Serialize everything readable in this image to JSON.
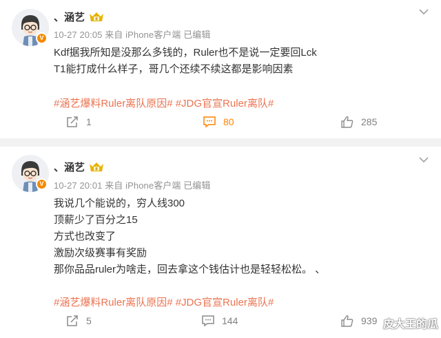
{
  "posts": [
    {
      "user": {
        "name": "、涵艺",
        "verified_badge": "V",
        "level_badge": "II"
      },
      "meta": "10-27 20:05  来自 iPhone客户端  已编辑",
      "content_lines": [
        "Kdf据我所知是没那么多钱的，Ruler也不是说一定要回Lck",
        "T1能打成什么样子，哥几个还续不续这都是影响因素"
      ],
      "tags": [
        "#涵艺爆料Ruler离队原因#",
        "#JDG官宣Ruler离队#"
      ],
      "actions": {
        "repost": "1",
        "comment": "80",
        "like": "285"
      }
    },
    {
      "user": {
        "name": "、涵艺",
        "verified_badge": "V",
        "level_badge": "II"
      },
      "meta": "10-27 20:01  来自 iPhone客户端  已编辑",
      "content_lines": [
        "我说几个能说的，穷人线300",
        "顶薪少了百分之15",
        "方式也改变了",
        "激励次级赛事有奖励",
        "那你品品ruler为啥走，回去拿这个钱估计也是轻轻松松。 、"
      ],
      "tags": [
        "#涵艺爆料Ruler离队原因#",
        "#JDG官宣Ruler离队#"
      ],
      "actions": {
        "repost": "5",
        "comment": "144",
        "like": "939"
      }
    }
  ],
  "watermark": "皮大王的瓜",
  "icons": {
    "repost": "repost-icon",
    "comment": "comment-icon",
    "like": "like-icon",
    "more": "chevron-down-icon"
  },
  "colors": {
    "tag": "#eb7350",
    "comment_active": "#ff8200",
    "meta": "#939393",
    "badge": "#f58a00"
  }
}
